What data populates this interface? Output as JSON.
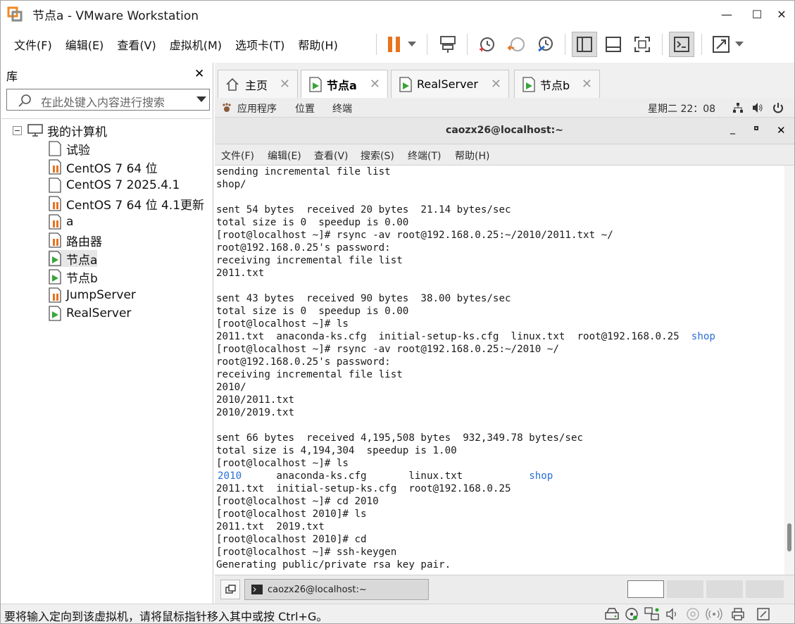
{
  "window": {
    "title": "节点a - VMware Workstation"
  },
  "menubar": [
    "文件(F)",
    "编辑(E)",
    "查看(V)",
    "虚拟机(M)",
    "选项卡(T)",
    "帮助(H)"
  ],
  "library": {
    "header": "库",
    "search_placeholder": "在此处键入内容进行搜索",
    "root": "我的计算机",
    "items": [
      {
        "label": "试验",
        "state": "plain"
      },
      {
        "label": "CentOS 7 64 位",
        "state": "paused"
      },
      {
        "label": "CentOS 7 2025.4.1",
        "state": "plain"
      },
      {
        "label": "CentOS 7 64 位 4.1更新",
        "state": "paused"
      },
      {
        "label": "a",
        "state": "paused"
      },
      {
        "label": "路由器",
        "state": "paused"
      },
      {
        "label": "节点a",
        "state": "running"
      },
      {
        "label": "节点b",
        "state": "running"
      },
      {
        "label": "JumpServer",
        "state": "paused"
      },
      {
        "label": "RealServer",
        "state": "running"
      }
    ]
  },
  "tabs": [
    {
      "label": "主页",
      "icon": "home-icon"
    },
    {
      "label": "节点a",
      "icon": "vm-running-icon"
    },
    {
      "label": "RealServer",
      "icon": "vm-running-icon"
    },
    {
      "label": "节点b",
      "icon": "vm-running-icon"
    }
  ],
  "gnome": {
    "apps": "应用程序",
    "places": "位置",
    "terminal": "终端",
    "clock": "星期二 22：08"
  },
  "terminal": {
    "title": "caozx26@localhost:~",
    "menu": [
      "文件(F)",
      "编辑(E)",
      "查看(V)",
      "搜索(S)",
      "终端(T)",
      "帮助(H)"
    ],
    "lines": [
      "sending incremental file list",
      "shop/",
      "",
      "sent 54 bytes  received 20 bytes  21.14 bytes/sec",
      "total size is 0  speedup is 0.00",
      "[root@localhost ~]# rsync -av root@192.168.0.25:~/2010/2011.txt ~/",
      "root@192.168.0.25's password:",
      "receiving incremental file list",
      "2011.txt",
      "",
      "sent 43 bytes  received 90 bytes  38.00 bytes/sec",
      "total size is 0  speedup is 0.00",
      "[root@localhost ~]# ls",
      "2011.txt  anaconda-ks.cfg  initial-setup-ks.cfg  linux.txt  root@192.168.0.25",
      "[root@localhost ~]# rsync -av root@192.168.0.25:~/2010 ~/",
      "root@192.168.0.25's password:",
      "receiving incremental file list",
      "2010/",
      "2010/2011.txt",
      "2010/2019.txt",
      "",
      "sent 66 bytes  received 4,195,508 bytes  932,349.78 bytes/sec",
      "total size is 4,194,304  speedup is 1.00",
      "[root@localhost ~]# ls",
      "          anaconda-ks.cfg       linux.txt",
      "2011.txt  initial-setup-ks.cfg  root@192.168.0.25",
      "[root@localhost ~]# cd 2010",
      "[root@localhost 2010]# ls",
      "2011.txt  2019.txt",
      "[root@localhost 2010]# cd",
      "[root@localhost ~]# ssh-keygen",
      "Generating public/private rsa key pair."
    ],
    "dir_shop": "shop",
    "dir_2010": "2010"
  },
  "taskbar": {
    "window_label": "caozx26@localhost:~"
  },
  "status": {
    "message": "要将输入定向到该虚拟机，请将鼠标指针移入其中或按 Ctrl+G。"
  },
  "colors": {
    "accent": "#e8731e",
    "dir": "#2a6fd6",
    "running": "#3aa43a",
    "paused": "#e8731e"
  }
}
